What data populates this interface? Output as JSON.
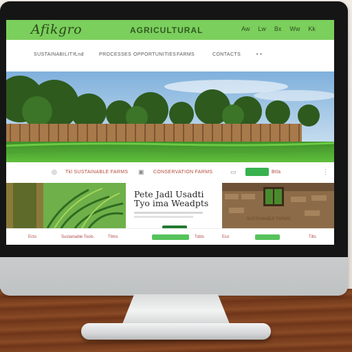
{
  "header": {
    "logo": "Afikgro",
    "title": "AGRICULTURAL",
    "links": [
      "Aw",
      "Lw",
      "Bx",
      "Ww",
      "Kk"
    ]
  },
  "nav": {
    "items": [
      "SUSTAINABILITY",
      "Lnd",
      "PROCESSES",
      "OPPORTUNITIES",
      "FARMS",
      "CONTACTS",
      "•  •"
    ]
  },
  "strip": {
    "left_text": "Tkl  SUSTAINABLE FARMS",
    "middle_text": "CONSERVATION FARMS",
    "right_text": "Btla"
  },
  "cards": {
    "headline_line1": "Pete Jadl Usadti",
    "headline_line2": "Tyo ima Weadpts",
    "caption": "SUSTAINABLE FARMS"
  },
  "footer": {
    "links": [
      "Ecto",
      "Sustainable Tools",
      "Ttlms",
      "Tsbts",
      "Eco",
      "Tilts"
    ]
  },
  "colors": {
    "brand_green": "#7bcf5c",
    "button_green": "#37b24d",
    "accent_red": "#b04a3a"
  }
}
